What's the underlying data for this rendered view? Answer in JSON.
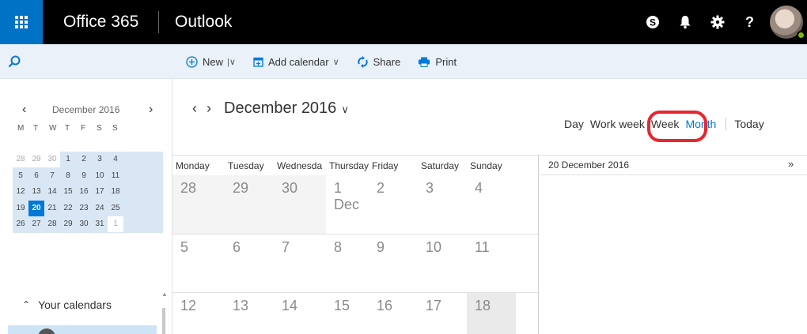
{
  "topbar": {
    "suite": "Office 365",
    "app": "Outlook",
    "icons": [
      "skype-icon",
      "bell-icon",
      "gear-icon",
      "help-icon"
    ],
    "help_label": "?"
  },
  "commands": {
    "new": "New",
    "add_calendar": "Add calendar",
    "share": "Share",
    "print": "Print"
  },
  "mini_calendar": {
    "title": "December 2016",
    "dow": [
      "M",
      "T",
      "W",
      "T",
      "F",
      "S",
      "S"
    ],
    "weeks": [
      [
        {
          "d": "28",
          "o": true
        },
        {
          "d": "29",
          "o": true
        },
        {
          "d": "30",
          "o": true
        },
        {
          "d": "1"
        },
        {
          "d": "2"
        },
        {
          "d": "3"
        },
        {
          "d": "4"
        }
      ],
      [
        {
          "d": "5"
        },
        {
          "d": "6"
        },
        {
          "d": "7"
        },
        {
          "d": "8"
        },
        {
          "d": "9"
        },
        {
          "d": "10"
        },
        {
          "d": "11"
        }
      ],
      [
        {
          "d": "12"
        },
        {
          "d": "13"
        },
        {
          "d": "14"
        },
        {
          "d": "15"
        },
        {
          "d": "16"
        },
        {
          "d": "17"
        },
        {
          "d": "18"
        }
      ],
      [
        {
          "d": "19"
        },
        {
          "d": "20",
          "today": true
        },
        {
          "d": "21"
        },
        {
          "d": "22"
        },
        {
          "d": "23"
        },
        {
          "d": "24"
        },
        {
          "d": "25"
        }
      ],
      [
        {
          "d": "26"
        },
        {
          "d": "27"
        },
        {
          "d": "28"
        },
        {
          "d": "29"
        },
        {
          "d": "30"
        },
        {
          "d": "31"
        },
        {
          "d": "1",
          "o": true
        }
      ]
    ]
  },
  "your_calendars": "Your calendars",
  "main": {
    "month_title": "December 2016",
    "views": [
      "Day",
      "Work week",
      "Week",
      "Month",
      "Today"
    ],
    "active_view": "Month",
    "highlighted_view": "Week",
    "days_of_week": [
      "Monday",
      "Tuesday",
      "Wednesda",
      "Thursday",
      "Friday",
      "Saturday",
      "Sunday"
    ],
    "weeks": [
      [
        "28",
        "29",
        "30",
        "1 Dec",
        "2",
        "3",
        "4"
      ],
      [
        "5",
        "6",
        "7",
        "8",
        "9",
        "10",
        "11"
      ],
      [
        "12",
        "13",
        "14",
        "15",
        "16",
        "17",
        "18"
      ]
    ]
  },
  "agenda": {
    "date": "20 December 2016",
    "expand": "»"
  },
  "colors": {
    "accent": "#0078d7",
    "waffle": "#0072c6",
    "highlight": "#e8262d"
  }
}
